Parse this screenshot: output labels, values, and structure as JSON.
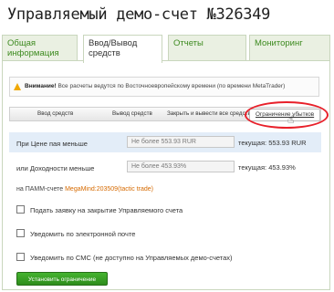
{
  "page": {
    "title": "Управляемый демо-счет №326349"
  },
  "tabs": [
    {
      "label": "Общая информация"
    },
    {
      "label": "Ввод/Вывод средств"
    },
    {
      "label": "Отчеты"
    },
    {
      "label": "Мониторинг"
    }
  ],
  "notice": {
    "bold": "Внимание!",
    "text": " Все расчеты ведутся по Восточноевропейскому времени (по времени MetaTrader)"
  },
  "subtabs": [
    {
      "label": "Ввод средств"
    },
    {
      "label": "Вывод средств"
    },
    {
      "label": "Закрыть и вывести все средства"
    },
    {
      "label": "Ограничение убытков"
    }
  ],
  "form": {
    "price_label": "При Цене пая меньше",
    "price_placeholder": "Не более 553.93 RUR",
    "price_current": "текущая: 553.93 RUR",
    "yield_label": "или Доходности меньше",
    "yield_placeholder": "Не более 453.93%",
    "yield_current": "текущая: 453.93%",
    "pamm_prefix": "на ПАММ-счете ",
    "pamm_link": "MegaMind:203509(tactic trade)",
    "cb1": "Подать заявку на закрытие Управляемого счета",
    "cb2": "Уведомить по электронной почте",
    "cb3": "Уведомить по СМС (не доступно на Управляемых демо-счетах)",
    "submit": "Установить ограничение"
  },
  "colors": {
    "accent_green": "#3d8a1f",
    "highlight_red": "#e8202a",
    "link_orange": "#d66a00"
  }
}
